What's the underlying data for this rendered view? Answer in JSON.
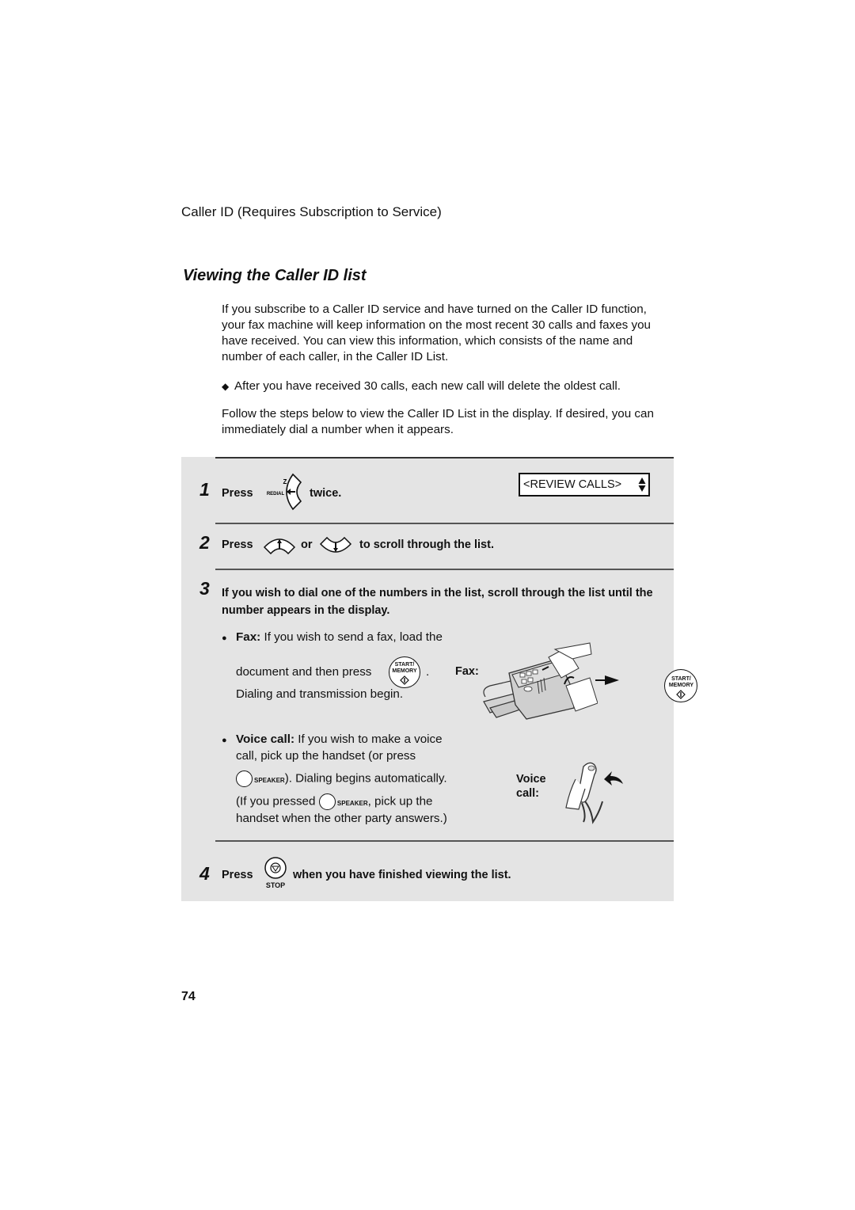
{
  "header": {
    "section": "Caller ID (Requires Subscription to Service)",
    "title": "Viewing the Caller ID list"
  },
  "intro": {
    "paragraph": "If you subscribe to a Caller ID service and have turned on the Caller ID function, your fax machine will keep information on the most recent 30 calls and faxes you have received. You can view this information, which consists of the name and number of each caller, in the Caller ID List.",
    "bullet": "After you have received 30 calls, each new call will delete the oldest call.",
    "follow": "Follow the steps below to view the Caller ID List in the display. If desired, you can immediately dial a number when it appears."
  },
  "steps": [
    {
      "number": "1",
      "press": "Press",
      "button": "REDIAL",
      "button_key": "Z",
      "after": "twice.",
      "display": "<REVIEW CALLS>"
    },
    {
      "number": "2",
      "press": "Press",
      "or": "or",
      "after": "to  scroll through the list."
    },
    {
      "number": "3",
      "text": "If you wish to dial one of the numbers in the list, scroll through the list until the number appears in the display.",
      "fax": {
        "label": "Fax:",
        "text_a": "If you wish to send a fax, load the",
        "text_b": "document and then press",
        "text_b_end": ".",
        "text_c": "Dialing and transmission begin.",
        "illus_label": "Fax:",
        "button_line1": "START/",
        "button_line2": "MEMORY"
      },
      "voice": {
        "label": "Voice call:",
        "text_a": "If you wish to make a voice",
        "text_b": "call, pick up the handset (or press",
        "speaker": "SPEAKER",
        "text_c": "). Dialing begins automatically.",
        "text_d_start": "(If you pressed",
        "text_d_end": ", pick up the",
        "text_e": "handset when the other party answers.)",
        "illus_label_1": "Voice",
        "illus_label_2": "call:"
      }
    },
    {
      "number": "4",
      "press": "Press",
      "button": "STOP",
      "after": "when you have finished viewing the list."
    }
  ],
  "footer": {
    "page_number": "74"
  }
}
